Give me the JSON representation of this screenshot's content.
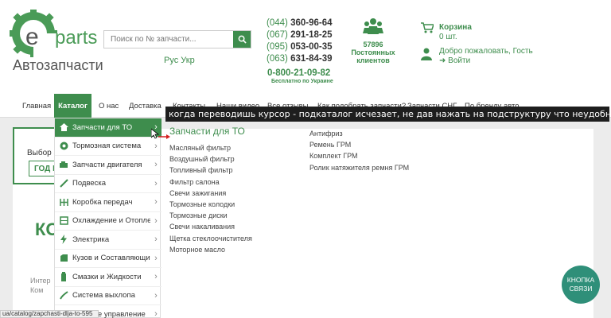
{
  "header": {
    "logo_parts": "parts",
    "logo_sub": "Автозапчасти",
    "search_placeholder": "Поиск по № запчасти...",
    "lang": "Рус Укр",
    "phones": [
      {
        "code": "(044)",
        "num": "360-96-64"
      },
      {
        "code": "(067)",
        "num": "291-18-25"
      },
      {
        "code": "(095)",
        "num": "053-00-35"
      },
      {
        "code": "(063)",
        "num": "631-84-39"
      }
    ],
    "free_phone": "0-800-21-09-82",
    "free_note": "Бесплатно по Украине",
    "clients_count": "57896",
    "clients_label": "Постоянных клиентов",
    "cart_title": "Корзина",
    "cart_count": "0 шт.",
    "welcome": "Добро пожаловать, Гость",
    "login": "Войти"
  },
  "nav": {
    "items": [
      "Главная",
      "Каталог",
      "О нас",
      "Доставка",
      "Контакты",
      "Наши видео",
      "Все отзывы",
      "Как подобрать запчасти?",
      "Запчасти СНГ",
      "По бренду авто"
    ]
  },
  "banner": "когда переводишь курсор - подкаталог исчезает, не дав нажать на подструктуру что неудобно пользователю",
  "page": {
    "pick_text": "Выбор а",
    "year_btn": "ГОД В",
    "big_letter": "КО",
    "crumb1": "Интер",
    "crumb2": "Ком"
  },
  "catalog": [
    {
      "label": "Запчасти для ТО",
      "icon": "home-icon"
    },
    {
      "label": "Тормозная система",
      "icon": "brake-icon"
    },
    {
      "label": "Запчасти двигателя",
      "icon": "engine-icon"
    },
    {
      "label": "Подвеска",
      "icon": "suspension-icon"
    },
    {
      "label": "Коробка передач",
      "icon": "gearbox-icon"
    },
    {
      "label": "Охлаждение и Отопление",
      "icon": "cooling-icon"
    },
    {
      "label": "Электрика",
      "icon": "lightning-icon"
    },
    {
      "label": "Кузов и Составляющие",
      "icon": "body-icon"
    },
    {
      "label": "Смазки и Жидкости",
      "icon": "oil-icon"
    },
    {
      "label": "Система выхлопа",
      "icon": "exhaust-icon"
    },
    {
      "label": "Рулевое управление",
      "icon": "steering-icon"
    }
  ],
  "submenu": {
    "title": "Запчасти для ТО",
    "col1": [
      "Масляный фильтр",
      "Воздушный фильтр",
      "Топливный фильтр",
      "Фильтр салона",
      "Свечи зажигания",
      "Тормозные колодки",
      "Тормозные диски",
      "Свечи накаливания",
      "Щетка стеклоочистителя",
      "Моторное масло"
    ],
    "col2": [
      "Антифриз",
      "Ремень ГРМ",
      "Комплект ГРМ",
      "Ролик натяжителя ремня ГРМ"
    ]
  },
  "contact_button": "КНОПКА СВЯЗИ",
  "status_url": "ua/catalog/zapchasti-dlja-to-595",
  "colors": {
    "brand": "#3e8d4d",
    "contact": "#2f8f79"
  }
}
